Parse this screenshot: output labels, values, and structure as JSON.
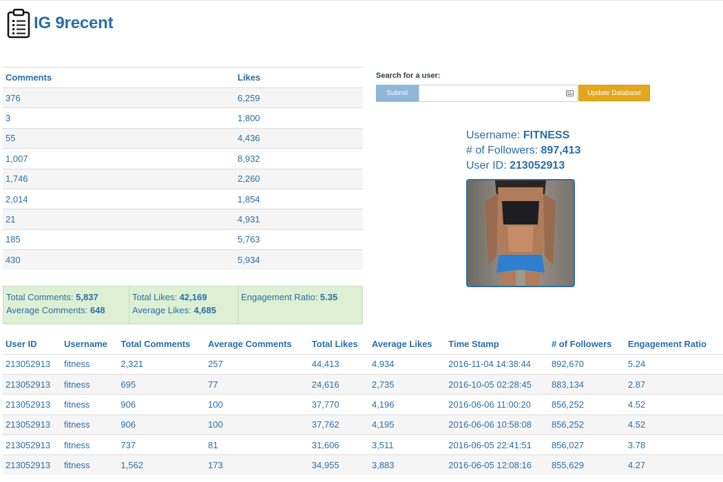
{
  "app": {
    "title": "IG 9recent"
  },
  "posts": {
    "headers": {
      "comments": "Comments",
      "likes": "Likes"
    },
    "rows": [
      {
        "comments": "376",
        "likes": "6,259"
      },
      {
        "comments": "3",
        "likes": "1,800"
      },
      {
        "comments": "55",
        "likes": "4,436"
      },
      {
        "comments": "1,007",
        "likes": "8,932"
      },
      {
        "comments": "1,746",
        "likes": "2,260"
      },
      {
        "comments": "2,014",
        "likes": "1,854"
      },
      {
        "comments": "21",
        "likes": "4,931"
      },
      {
        "comments": "185",
        "likes": "5,763"
      },
      {
        "comments": "430",
        "likes": "5,934"
      }
    ]
  },
  "stats": {
    "total_comments_label": "Total Comments:",
    "total_comments": "5,837",
    "avg_comments_label": "Average Comments:",
    "avg_comments": "648",
    "total_likes_label": "Total Likes:",
    "total_likes": "42,169",
    "avg_likes_label": "Average Likes:",
    "avg_likes": "4,685",
    "engagement_label": "Engagement Ratio:",
    "engagement": "5.35"
  },
  "search": {
    "label": "Search for a user:",
    "submit_label": "Submit",
    "input_value": "",
    "placeholder": "",
    "update_label": "Update Database"
  },
  "profile": {
    "username_label": "Username:",
    "username": "FITNESS",
    "followers_label": "# of Followers:",
    "followers": "897,413",
    "userid_label": "User ID:",
    "userid": "213052913"
  },
  "history": {
    "headers": [
      "User ID",
      "Username",
      "Total Comments",
      "Average Comments",
      "Total Likes",
      "Average Likes",
      "Time Stamp",
      "# of Followers",
      "Engagement Ratio"
    ],
    "rows": [
      [
        "213052913",
        "fitness",
        "2,321",
        "257",
        "44,413",
        "4,934",
        "2016-11-04 14:38:44",
        "892,670",
        "5.24"
      ],
      [
        "213052913",
        "fitness",
        "695",
        "77",
        "24,616",
        "2,735",
        "2016-10-05 02:28:45",
        "883,134",
        "2.87"
      ],
      [
        "213052913",
        "fitness",
        "906",
        "100",
        "37,770",
        "4,196",
        "2016-06-06 11:00:20",
        "856,252",
        "4.52"
      ],
      [
        "213052913",
        "fitness",
        "906",
        "100",
        "37,762",
        "4,195",
        "2016-06-06 10:58:08",
        "856,252",
        "4.52"
      ],
      [
        "213052913",
        "fitness",
        "737",
        "81",
        "31,606",
        "3,511",
        "2016-06-05 22:41:51",
        "856,027",
        "3.78"
      ],
      [
        "213052913",
        "fitness",
        "1,562",
        "173",
        "34,955",
        "3,883",
        "2016-06-05 12:08:16",
        "855,629",
        "4.27"
      ]
    ]
  },
  "colors": {
    "accent": "#2a6ea8",
    "submit": "#8fb7da",
    "update": "#e3a71f",
    "stats_bg": "#ddf0d3"
  }
}
